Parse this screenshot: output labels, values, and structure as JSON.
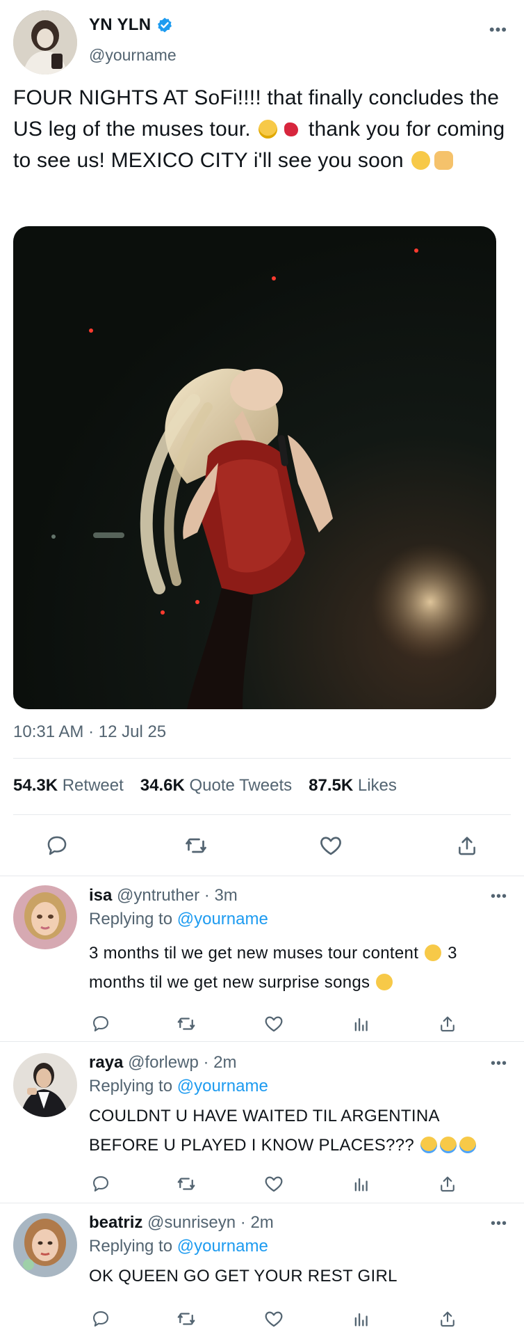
{
  "tweet": {
    "display_name": "YN YLN",
    "handle": "@yourname",
    "text_parts": [
      "FOUR NIGHTS AT SoFi!!!! that finally concludes the US leg of the muses tour. ",
      " thank you for coming to see us! MEXICO CITY i'll see you soon "
    ],
    "timestamp": "10:31 AM · 12 Jul 25",
    "stats": {
      "retweets": "54.3K",
      "retweets_label": "Retweet",
      "quotes": "34.6K",
      "quotes_label": "Quote Tweets",
      "likes": "87.5K",
      "likes_label": "Likes"
    },
    "more": "•••"
  },
  "replies": [
    {
      "name": "isa",
      "meta": "@yntruther · 3m",
      "replying_prefix": "Replying to ",
      "replying_to": "@yourname",
      "text_a": "3 months til we get new muses tour content ",
      "text_b": " 3 months til we get new surprise songs ",
      "more": "•••"
    },
    {
      "name": "raya",
      "meta": "@forlewp · 2m",
      "replying_prefix": "Replying to ",
      "replying_to": "@yourname",
      "text_a": "COULDNT U HAVE WAITED TIL ARGENTINA BEFORE U PLAYED I KNOW PLACES??? ",
      "more": "•••"
    },
    {
      "name": "beatriz",
      "meta": "@sunriseyn · 2m",
      "replying_prefix": "Replying to ",
      "replying_to": "@yourname",
      "text_a": "OK QUEEN GO GET YOUR REST GIRL",
      "more": "•••"
    }
  ],
  "colors": {
    "accent": "#1d9bf0",
    "muted": "#536471",
    "text": "#0f1419"
  },
  "icons": [
    "verified-icon",
    "reply-icon",
    "retweet-icon",
    "like-icon",
    "share-icon",
    "analytics-icon",
    "more-icon"
  ]
}
